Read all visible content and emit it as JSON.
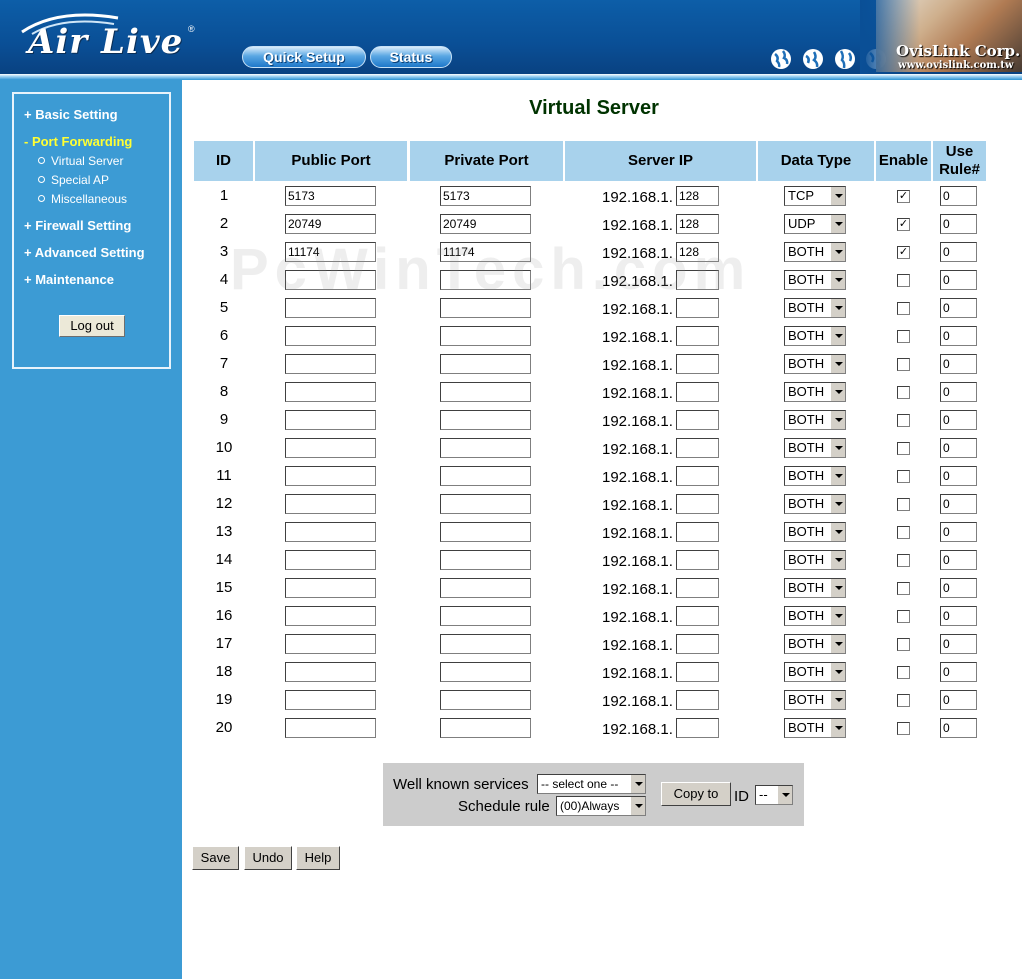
{
  "header": {
    "logo": "Air Live",
    "logo_reg": "®",
    "nav": {
      "quick_setup": "Quick Setup",
      "status": "Status"
    },
    "brand": "OvisLink Corp.",
    "brand_url": "www.ovislink.com.tw"
  },
  "sidebar": {
    "basic_setting": "+ Basic Setting",
    "port_forwarding": "- Port Forwarding",
    "virtual_server": "Virtual Server",
    "special_ap": "Special AP",
    "miscellaneous": "Miscellaneous",
    "firewall_setting": "+ Firewall Setting",
    "advanced_setting": "+ Advanced Setting",
    "maintenance": "+ Maintenance",
    "logout": "Log out"
  },
  "main": {
    "title": "Virtual Server",
    "watermark": "PcWinTech.com",
    "columns": {
      "id": "ID",
      "public_port": "Public Port",
      "private_port": "Private Port",
      "server_ip": "Server IP",
      "data_type": "Data Type",
      "enable": "Enable",
      "use_rule_1": "Use",
      "use_rule_2": "Rule#"
    },
    "ip_prefix": "192.168.1.",
    "rows": [
      {
        "id": "1",
        "public": "5173",
        "private": "5173",
        "ip": "128",
        "type": "TCP",
        "enabled": true,
        "rule": "0"
      },
      {
        "id": "2",
        "public": "20749",
        "private": "20749",
        "ip": "128",
        "type": "UDP",
        "enabled": true,
        "rule": "0"
      },
      {
        "id": "3",
        "public": "11174",
        "private": "11174",
        "ip": "128",
        "type": "BOTH",
        "enabled": true,
        "rule": "0"
      },
      {
        "id": "4",
        "public": "",
        "private": "",
        "ip": "",
        "type": "BOTH",
        "enabled": false,
        "rule": "0"
      },
      {
        "id": "5",
        "public": "",
        "private": "",
        "ip": "",
        "type": "BOTH",
        "enabled": false,
        "rule": "0"
      },
      {
        "id": "6",
        "public": "",
        "private": "",
        "ip": "",
        "type": "BOTH",
        "enabled": false,
        "rule": "0"
      },
      {
        "id": "7",
        "public": "",
        "private": "",
        "ip": "",
        "type": "BOTH",
        "enabled": false,
        "rule": "0"
      },
      {
        "id": "8",
        "public": "",
        "private": "",
        "ip": "",
        "type": "BOTH",
        "enabled": false,
        "rule": "0"
      },
      {
        "id": "9",
        "public": "",
        "private": "",
        "ip": "",
        "type": "BOTH",
        "enabled": false,
        "rule": "0"
      },
      {
        "id": "10",
        "public": "",
        "private": "",
        "ip": "",
        "type": "BOTH",
        "enabled": false,
        "rule": "0"
      },
      {
        "id": "11",
        "public": "",
        "private": "",
        "ip": "",
        "type": "BOTH",
        "enabled": false,
        "rule": "0"
      },
      {
        "id": "12",
        "public": "",
        "private": "",
        "ip": "",
        "type": "BOTH",
        "enabled": false,
        "rule": "0"
      },
      {
        "id": "13",
        "public": "",
        "private": "",
        "ip": "",
        "type": "BOTH",
        "enabled": false,
        "rule": "0"
      },
      {
        "id": "14",
        "public": "",
        "private": "",
        "ip": "",
        "type": "BOTH",
        "enabled": false,
        "rule": "0"
      },
      {
        "id": "15",
        "public": "",
        "private": "",
        "ip": "",
        "type": "BOTH",
        "enabled": false,
        "rule": "0"
      },
      {
        "id": "16",
        "public": "",
        "private": "",
        "ip": "",
        "type": "BOTH",
        "enabled": false,
        "rule": "0"
      },
      {
        "id": "17",
        "public": "",
        "private": "",
        "ip": "",
        "type": "BOTH",
        "enabled": false,
        "rule": "0"
      },
      {
        "id": "18",
        "public": "",
        "private": "",
        "ip": "",
        "type": "BOTH",
        "enabled": false,
        "rule": "0"
      },
      {
        "id": "19",
        "public": "",
        "private": "",
        "ip": "",
        "type": "BOTH",
        "enabled": false,
        "rule": "0"
      },
      {
        "id": "20",
        "public": "",
        "private": "",
        "ip": "",
        "type": "BOTH",
        "enabled": false,
        "rule": "0"
      }
    ],
    "services_panel": {
      "well_known_label": "Well known services",
      "well_known_value": "-- select one --",
      "schedule_label": "Schedule rule",
      "schedule_value": "(00)Always",
      "copy_to": "Copy to",
      "id_label": "ID",
      "id_value": "--"
    },
    "actions": {
      "save": "Save",
      "undo": "Undo",
      "help": "Help"
    }
  }
}
